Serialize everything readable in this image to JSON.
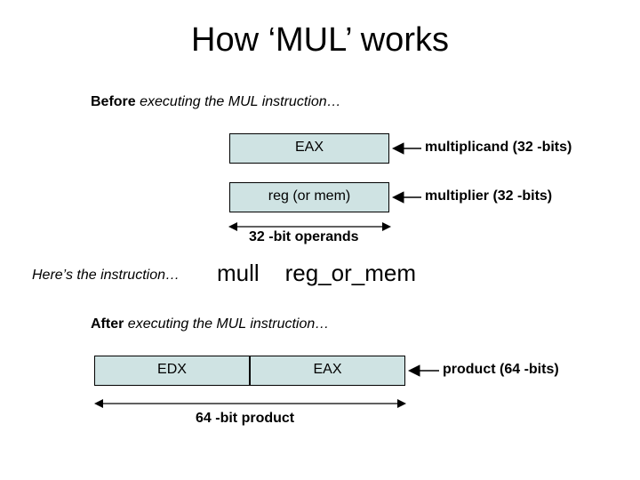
{
  "title": "How ‘MUL’ works",
  "before": {
    "prefix_bold": "Before",
    "rest": " executing the MUL instruction…"
  },
  "boxes": {
    "eax_top": "EAX",
    "reg_or_mem": "reg (or mem)",
    "edx": "EDX",
    "eax_bottom": "EAX"
  },
  "labels": {
    "multiplicand": "multiplicand (32 -bits)",
    "multiplier": "multiplier (32 -bits)",
    "operands32": "32 -bit operands",
    "product": "product (64 -bits)",
    "product64": "64 -bit product"
  },
  "instruction": {
    "here": "Here’s the instruction…",
    "mnemonic": "mull",
    "operand": "reg_or_mem"
  },
  "after": {
    "prefix_bold": "After",
    "rest": " executing the MUL instruction…"
  }
}
